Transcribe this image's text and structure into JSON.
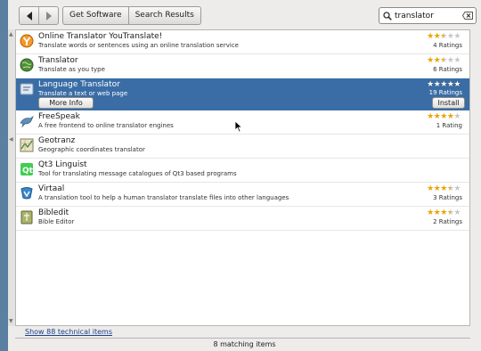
{
  "toolbar": {
    "back_icon": "arrow-left-icon",
    "forward_icon": "arrow-right-icon",
    "breadcrumbs": [
      "Get Software",
      "Search Results"
    ],
    "search": {
      "value": "translator",
      "icon": "search-icon",
      "clear_icon": "clear-icon"
    }
  },
  "colors": {
    "selection": "#3a6da5",
    "star": "#e9a400",
    "link": "#1a3f86"
  },
  "apps": [
    {
      "name": "Online Translator YouTranslate!",
      "description": "Translate words or sentences using an online translation service",
      "icon": "youtranslate-icon",
      "rating": 2.5,
      "rating_text": "4 Ratings"
    },
    {
      "name": "Translator",
      "description": "Translate as you type",
      "icon": "globe-icon",
      "rating": 2.5,
      "rating_text": "6 Ratings"
    },
    {
      "name": "Language Translator",
      "description": "Translate a text or web page",
      "icon": "language-translator-icon",
      "rating": 5,
      "rating_text": "19 Ratings",
      "selected": true,
      "more_info_label": "More Info",
      "install_label": "Install"
    },
    {
      "name": "FreeSpeak",
      "description": "A free frontend to online translator engines",
      "icon": "dolphin-icon",
      "rating": 4,
      "rating_text": "1 Rating"
    },
    {
      "name": "Geotranz",
      "description": "Geographic coordinates translator",
      "icon": "geotranz-icon"
    },
    {
      "name": "Qt3 Linguist",
      "description": "Tool for translating message catalogues of Qt3 based programs",
      "icon": "qt-icon"
    },
    {
      "name": "Virtaal",
      "description": "A translation tool to help a human translator translate files into other languages",
      "icon": "virtaal-icon",
      "rating": 3.5,
      "rating_text": "3 Ratings"
    },
    {
      "name": "Bibledit",
      "description": "Bible Editor",
      "icon": "bible-icon",
      "rating": 3.5,
      "rating_text": "2 Ratings"
    }
  ],
  "footer": {
    "technical_link": "Show 88 technical items",
    "status": "8 matching items"
  }
}
